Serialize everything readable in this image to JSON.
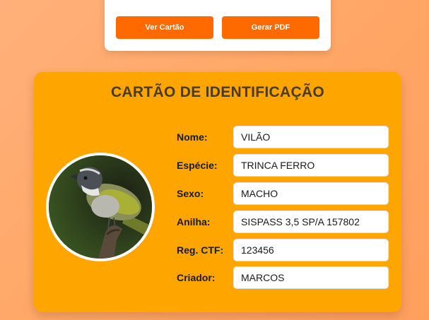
{
  "actions": {
    "view_card_label": "Ver Cartão",
    "generate_pdf_label": "Gerar PDF"
  },
  "card": {
    "title": "CARTÃO DE IDENTIFICAÇÃO",
    "fields": [
      {
        "label": "Nome:",
        "value": "VILÃO"
      },
      {
        "label": "Espécie:",
        "value": "TRINCA FERRO"
      },
      {
        "label": "Sexo:",
        "value": "MACHO"
      },
      {
        "label": "Anilha:",
        "value": "SISPASS 3,5 SP/A 157802"
      },
      {
        "label": "Reg. CTF:",
        "value": "123456"
      },
      {
        "label": "Criador:",
        "value": "MARCOS"
      }
    ]
  },
  "colors": {
    "accent_button": "#ff6a00",
    "card_background": "#ffa500",
    "title_text": "#4a3b1c"
  }
}
